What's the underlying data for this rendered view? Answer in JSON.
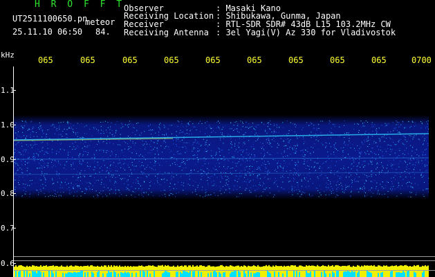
{
  "header": {
    "brand": "H R O F F T",
    "filename": "UT2511100650.pn",
    "filename_suffix": "meteor",
    "datetime": "25.11.10 06:50",
    "count": "84.",
    "rows": [
      {
        "label": "Observer",
        "value": ": Masaki Kano"
      },
      {
        "label": "Receiving Location",
        "value": ": Shibukawa, Gunma, Japan"
      },
      {
        "label": "Receiver",
        "value": ": RTL-SDR SDR# 43dB L15 103.2MHz CW"
      },
      {
        "label": "Receiving Antenna",
        "value": ": 3el Yagi(V) Az 330 for Vladivostok"
      }
    ]
  },
  "axes": {
    "y_unit": "kHz",
    "y_ticks": [
      "1.1",
      "1.0",
      "0.9",
      "0.8",
      "0.7",
      "0.6"
    ],
    "x_ticks": [
      "065",
      "065",
      "065",
      "065",
      "065",
      "065",
      "065",
      "065",
      "065",
      "0700"
    ]
  },
  "colors": {
    "label_green": "#2ee62e",
    "tick_yellow": "#ffff33",
    "spectrum_base": "#0a1a8c",
    "signal_cyan": "#30d0ff",
    "bottom_yellow": "#f0f000",
    "bottom_cyan": "#00e0ff"
  }
}
